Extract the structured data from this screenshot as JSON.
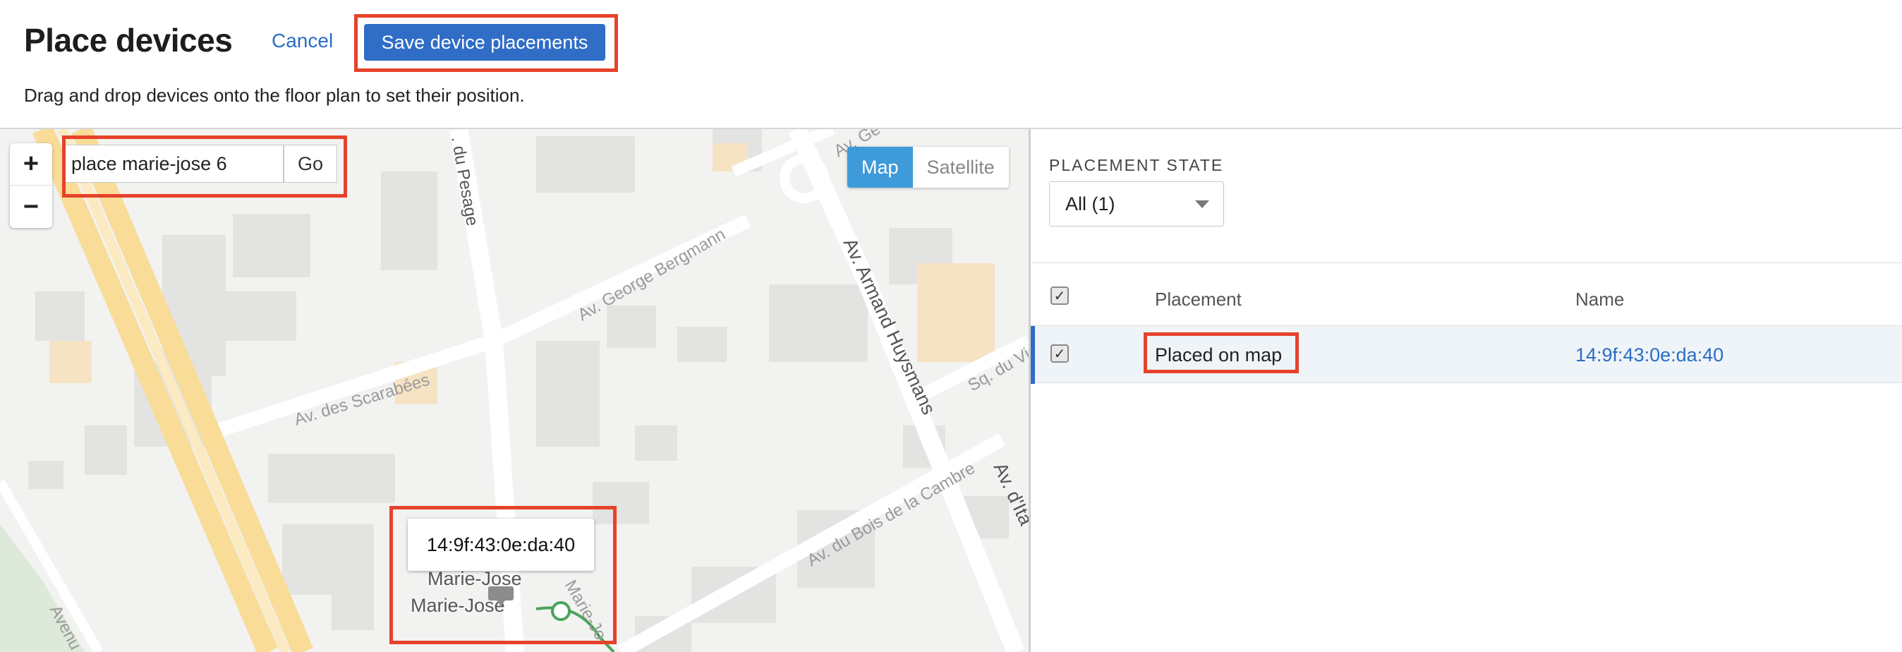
{
  "header": {
    "title": "Place devices",
    "cancel_label": "Cancel",
    "save_label": "Save device placements",
    "subtitle": "Drag and drop devices onto the floor plan to set their position."
  },
  "map": {
    "zoom_in": "+",
    "zoom_out": "−",
    "search_value": "place marie-jose 6",
    "go_label": "Go",
    "type_map": "Map",
    "type_satellite": "Satellite",
    "device_tooltip": "14:9f:43:0e:da:40",
    "place_label_1": "Marie-Jose",
    "place_label_2": "Marie-Jose",
    "streets": {
      "du_pesage": ". du Pesage",
      "george_bergmann": "Av. George Bergmann",
      "armand_huysmans": "Av. Armand Huysmans",
      "scarabees": "Av. des Scarabées",
      "bois_de_la_cambre": "Av. du Bois de la Cambre",
      "sq_du_v": "Sq. du Vi",
      "av_d_ita": "Av. d'Ita",
      "av_ge": "Av. Ge",
      "avenue": "Avenu",
      "marie_jose": "Marie-Jo"
    },
    "colors": {
      "highway": "#f8dc98",
      "road": "#ffffff",
      "block": "#e5e5e3",
      "park": "#dde9d9",
      "route": "#4aa35a"
    }
  },
  "panel": {
    "placement_state_label": "PLACEMENT STATE",
    "placement_state_value": "All (1)",
    "col_placement": "Placement",
    "col_name": "Name",
    "rows": [
      {
        "placement": "Placed on map",
        "name": "14:9f:43:0e:da:40",
        "checked": true
      }
    ],
    "check_glyph": "✓",
    "accent": "#2f6dc6"
  },
  "highlight_color": "#e6422b"
}
